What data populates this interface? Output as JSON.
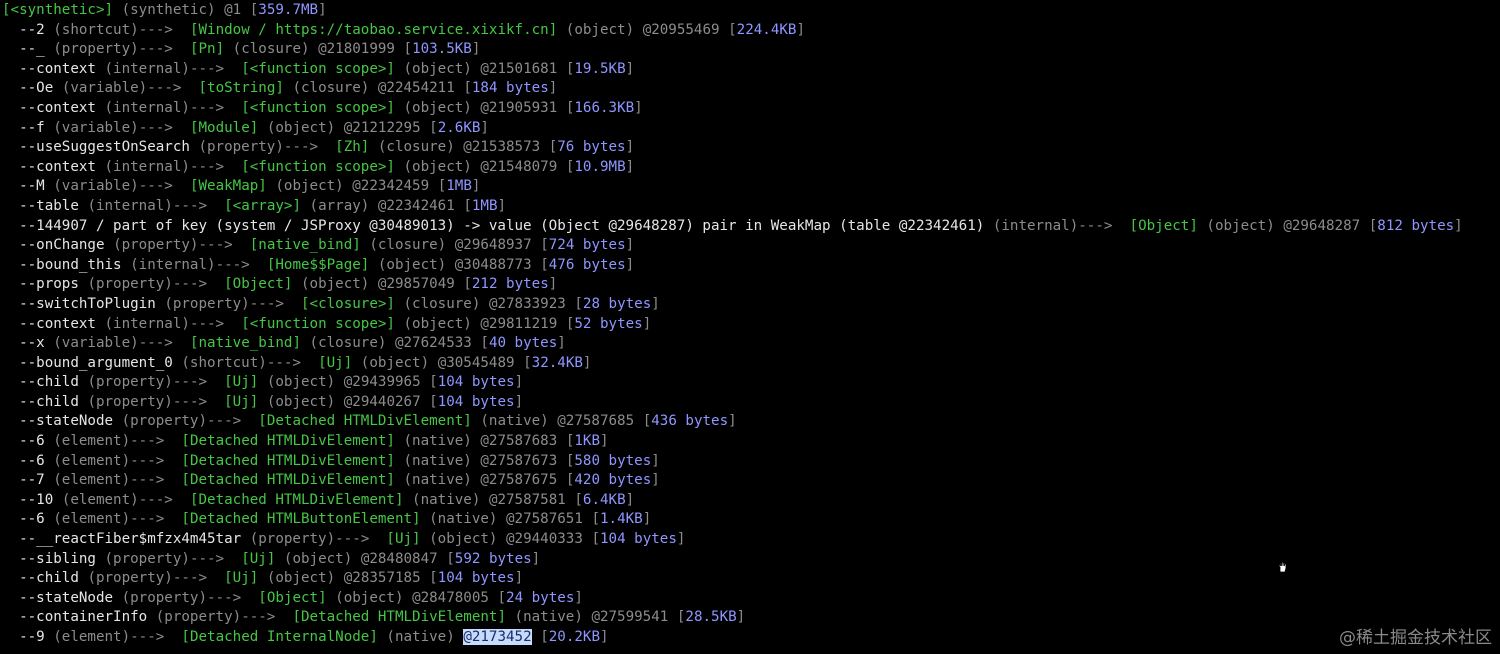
{
  "colors": {
    "background": "#000000",
    "node": "#45c645",
    "size": "#8f96ff",
    "dim": "#8c8c8c",
    "text": "#e6e6e6",
    "highlight": "#c7dcfa"
  },
  "root": {
    "node": "[<synthetic>]",
    "type": "(synthetic)",
    "id": "@1",
    "size": "359.7MB"
  },
  "rows": [
    {
      "prefix": "  --",
      "name": "2",
      "type": "(shortcut)",
      "node": "[Window / https://taobao.service.xixikf.cn]",
      "kind": "(object)",
      "id": "@20955469",
      "size": "224.4KB"
    },
    {
      "prefix": "  --",
      "name": "_",
      "type": "(property)",
      "node": "[Pn]",
      "kind": "(closure)",
      "id": "@21801999",
      "size": "103.5KB"
    },
    {
      "prefix": "  --",
      "name": "context",
      "type": "(internal)",
      "node": "[<function scope>]",
      "kind": "(object)",
      "id": "@21501681",
      "size": "19.5KB"
    },
    {
      "prefix": "  --",
      "name": "Oe",
      "type": "(variable)",
      "node": "[toString]",
      "kind": "(closure)",
      "id": "@22454211",
      "size": "184 bytes"
    },
    {
      "prefix": "  --",
      "name": "context",
      "type": "(internal)",
      "node": "[<function scope>]",
      "kind": "(object)",
      "id": "@21905931",
      "size": "166.3KB"
    },
    {
      "prefix": "  --",
      "name": "f",
      "type": "(variable)",
      "node": "[Module]",
      "kind": "(object)",
      "id": "@21212295",
      "size": "2.6KB"
    },
    {
      "prefix": "  --",
      "name": "useSuggestOnSearch",
      "type": "(property)",
      "node": "[Zh]",
      "kind": "(closure)",
      "id": "@21538573",
      "size": "76 bytes"
    },
    {
      "prefix": "  --",
      "name": "context",
      "type": "(internal)",
      "node": "[<function scope>]",
      "kind": "(object)",
      "id": "@21548079",
      "size": "10.9MB"
    },
    {
      "prefix": "  --",
      "name": "M",
      "type": "(variable)",
      "node": "[WeakMap]",
      "kind": "(object)",
      "id": "@22342459",
      "size": "1MB"
    },
    {
      "prefix": "  --",
      "name": "table",
      "type": "(internal)",
      "node": "[<array>]",
      "kind": "(array)",
      "id": "@22342461",
      "size": "1MB"
    },
    {
      "prefix": "  --",
      "name": "144907 / part of key (system / JSProxy @30489013) -> value (Object @29648287) pair in WeakMap (table @22342461)",
      "type": "(internal)",
      "node": "[Object]",
      "kind": "(object)",
      "id": "@29648287",
      "size": "812 bytes"
    },
    {
      "prefix": "  --",
      "name": "onChange",
      "type": "(property)",
      "node": "[native_bind]",
      "kind": "(closure)",
      "id": "@29648937",
      "size": "724 bytes"
    },
    {
      "prefix": "  --",
      "name": "bound_this",
      "type": "(internal)",
      "node": "[Home$$Page]",
      "kind": "(object)",
      "id": "@30488773",
      "size": "476 bytes"
    },
    {
      "prefix": "  --",
      "name": "props",
      "type": "(property)",
      "node": "[Object]",
      "kind": "(object)",
      "id": "@29857049",
      "size": "212 bytes"
    },
    {
      "prefix": "  --",
      "name": "switchToPlugin",
      "type": "(property)",
      "node": "[<closure>]",
      "kind": "(closure)",
      "id": "@27833923",
      "size": "28 bytes"
    },
    {
      "prefix": "  --",
      "name": "context",
      "type": "(internal)",
      "node": "[<function scope>]",
      "kind": "(object)",
      "id": "@29811219",
      "size": "52 bytes"
    },
    {
      "prefix": "  --",
      "name": "x",
      "type": "(variable)",
      "node": "[native_bind]",
      "kind": "(closure)",
      "id": "@27624533",
      "size": "40 bytes"
    },
    {
      "prefix": "  --",
      "name": "bound_argument_0",
      "type": "(shortcut)",
      "node": "[Uj]",
      "kind": "(object)",
      "id": "@30545489",
      "size": "32.4KB"
    },
    {
      "prefix": "  --",
      "name": "child",
      "type": "(property)",
      "node": "[Uj]",
      "kind": "(object)",
      "id": "@29439965",
      "size": "104 bytes"
    },
    {
      "prefix": "  --",
      "name": "child",
      "type": "(property)",
      "node": "[Uj]",
      "kind": "(object)",
      "id": "@29440267",
      "size": "104 bytes"
    },
    {
      "prefix": "  --",
      "name": "stateNode",
      "type": "(property)",
      "node": "[Detached HTMLDivElement]",
      "kind": "(native)",
      "id": "@27587685",
      "size": "436 bytes"
    },
    {
      "prefix": "  --",
      "name": "6",
      "type": "(element)",
      "node": "[Detached HTMLDivElement]",
      "kind": "(native)",
      "id": "@27587683",
      "size": "1KB"
    },
    {
      "prefix": "  --",
      "name": "6",
      "type": "(element)",
      "node": "[Detached HTMLDivElement]",
      "kind": "(native)",
      "id": "@27587673",
      "size": "580 bytes"
    },
    {
      "prefix": "  --",
      "name": "7",
      "type": "(element)",
      "node": "[Detached HTMLDivElement]",
      "kind": "(native)",
      "id": "@27587675",
      "size": "420 bytes"
    },
    {
      "prefix": "  --",
      "name": "10",
      "type": "(element)",
      "node": "[Detached HTMLDivElement]",
      "kind": "(native)",
      "id": "@27587581",
      "size": "6.4KB"
    },
    {
      "prefix": "  --",
      "name": "6",
      "type": "(element)",
      "node": "[Detached HTMLButtonElement]",
      "kind": "(native)",
      "id": "@27587651",
      "size": "1.4KB"
    },
    {
      "prefix": "  --",
      "name": "__reactFiber$mfzx4m45tar",
      "type": "(property)",
      "node": "[Uj]",
      "kind": "(object)",
      "id": "@29440333",
      "size": "104 bytes"
    },
    {
      "prefix": "  --",
      "name": "sibling",
      "type": "(property)",
      "node": "[Uj]",
      "kind": "(object)",
      "id": "@28480847",
      "size": "592 bytes"
    },
    {
      "prefix": "  --",
      "name": "child",
      "type": "(property)",
      "node": "[Uj]",
      "kind": "(object)",
      "id": "@28357185",
      "size": "104 bytes"
    },
    {
      "prefix": "  --",
      "name": "stateNode",
      "type": "(property)",
      "node": "[Object]",
      "kind": "(object)",
      "id": "@28478005",
      "size": "24 bytes"
    },
    {
      "prefix": "  --",
      "name": "containerInfo",
      "type": "(property)",
      "node": "[Detached HTMLDivElement]",
      "kind": "(native)",
      "id": "@27599541",
      "size": "28.5KB"
    },
    {
      "prefix": "  --",
      "name": "9",
      "type": "(element)",
      "node": "[Detached InternalNode]",
      "kind": "(native)",
      "id": "@2173452",
      "size": "20.2KB",
      "highlight": true
    }
  ],
  "arrow": "--->",
  "watermark": "@稀土掘金技术社区",
  "cursor_icon": "hand-cursor-icon"
}
